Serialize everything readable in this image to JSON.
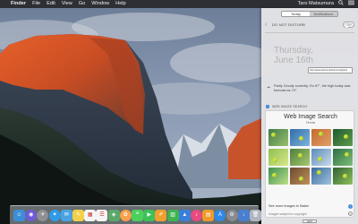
{
  "menubar": {
    "apple_glyph": "",
    "menus": [
      "Finder",
      "File",
      "Edit",
      "View",
      "Go",
      "Window",
      "Help"
    ],
    "user": "Taro Matsumura",
    "status_icons": [
      "search-icon",
      "notification-center-icon"
    ]
  },
  "notification_center": {
    "tabs": [
      "Today",
      "Notifications"
    ],
    "active_tab": "Today",
    "dnd": {
      "label": "DO NOT DISTURB",
      "toggle": "OFF",
      "enabled": false
    },
    "date_line1": "Thursday,",
    "date_line2": "June 16th",
    "url": "http://www.actionmethod.com/gtis/ex",
    "weather": "Partly Cloudy currently. It’s 67°, the high today was forecast as 70°.",
    "widget": {
      "label": "WEB IMAGE SEARCH",
      "title": "Web Image Search",
      "query": "Tennis",
      "more": "See more images in Safari",
      "copyright": "Images subject to copyright",
      "image_count": 12
    },
    "edit_button": "Edit"
  },
  "colors": {
    "accent": "#4a90d9",
    "menubar": "#28282c",
    "panel": "#e4e4e6"
  },
  "dock": {
    "apps": [
      {
        "name": "finder-icon",
        "glyph": "☺"
      },
      {
        "name": "siri-icon",
        "glyph": "◉"
      },
      {
        "name": "launchpad-icon",
        "glyph": "✈"
      },
      {
        "name": "safari-icon",
        "glyph": "✦"
      },
      {
        "name": "mail-icon",
        "glyph": "✉"
      },
      {
        "name": "notes-icon",
        "glyph": "✎"
      },
      {
        "name": "calendar-icon",
        "glyph": "▦"
      },
      {
        "name": "reminders-icon",
        "glyph": "☰"
      },
      {
        "name": "maps-icon",
        "glyph": "◈"
      },
      {
        "name": "photos-icon",
        "glyph": "✿"
      },
      {
        "name": "messages-icon",
        "glyph": "❝"
      },
      {
        "name": "facetime-icon",
        "glyph": "▶"
      },
      {
        "name": "pages-icon",
        "glyph": "✐"
      },
      {
        "name": "numbers-icon",
        "glyph": "▥"
      },
      {
        "name": "keynote-icon",
        "glyph": "▲"
      },
      {
        "name": "itunes-icon",
        "glyph": "♪"
      },
      {
        "name": "ibooks-icon",
        "glyph": "▤"
      },
      {
        "name": "app-store-icon",
        "glyph": "A"
      },
      {
        "name": "system-preferences-icon",
        "glyph": "⚙"
      },
      {
        "name": "downloads-icon",
        "glyph": "↓"
      },
      {
        "name": "trash-icon",
        "glyph": "🗑"
      }
    ]
  }
}
